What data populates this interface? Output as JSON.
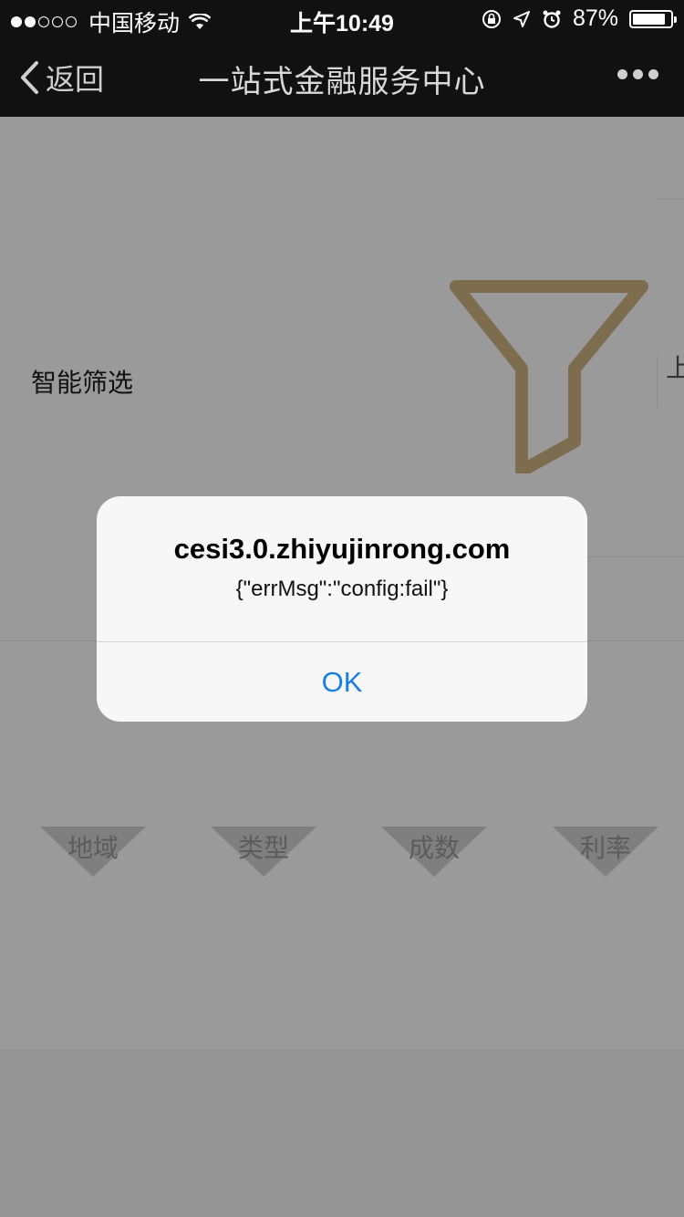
{
  "status_bar": {
    "carrier": "中国移动",
    "time": "上午10:49",
    "battery_text": "87%",
    "battery_level": 0.87
  },
  "nav": {
    "back_label": "返回",
    "title": "一站式金融服务中心"
  },
  "page": {
    "smart_filter_label": "智能筛选",
    "clipped_char": "上",
    "filters": [
      "地域",
      "类型",
      "成数",
      "利率"
    ]
  },
  "alert": {
    "title": "cesi3.0.zhiyujinrong.com",
    "message": "{\"errMsg\":\"config:fail\"}",
    "ok_label": "OK"
  },
  "colors": {
    "accent": "#1a7ee6",
    "funnel": "#7d6c4e",
    "overlay": "#9a9a9a"
  }
}
